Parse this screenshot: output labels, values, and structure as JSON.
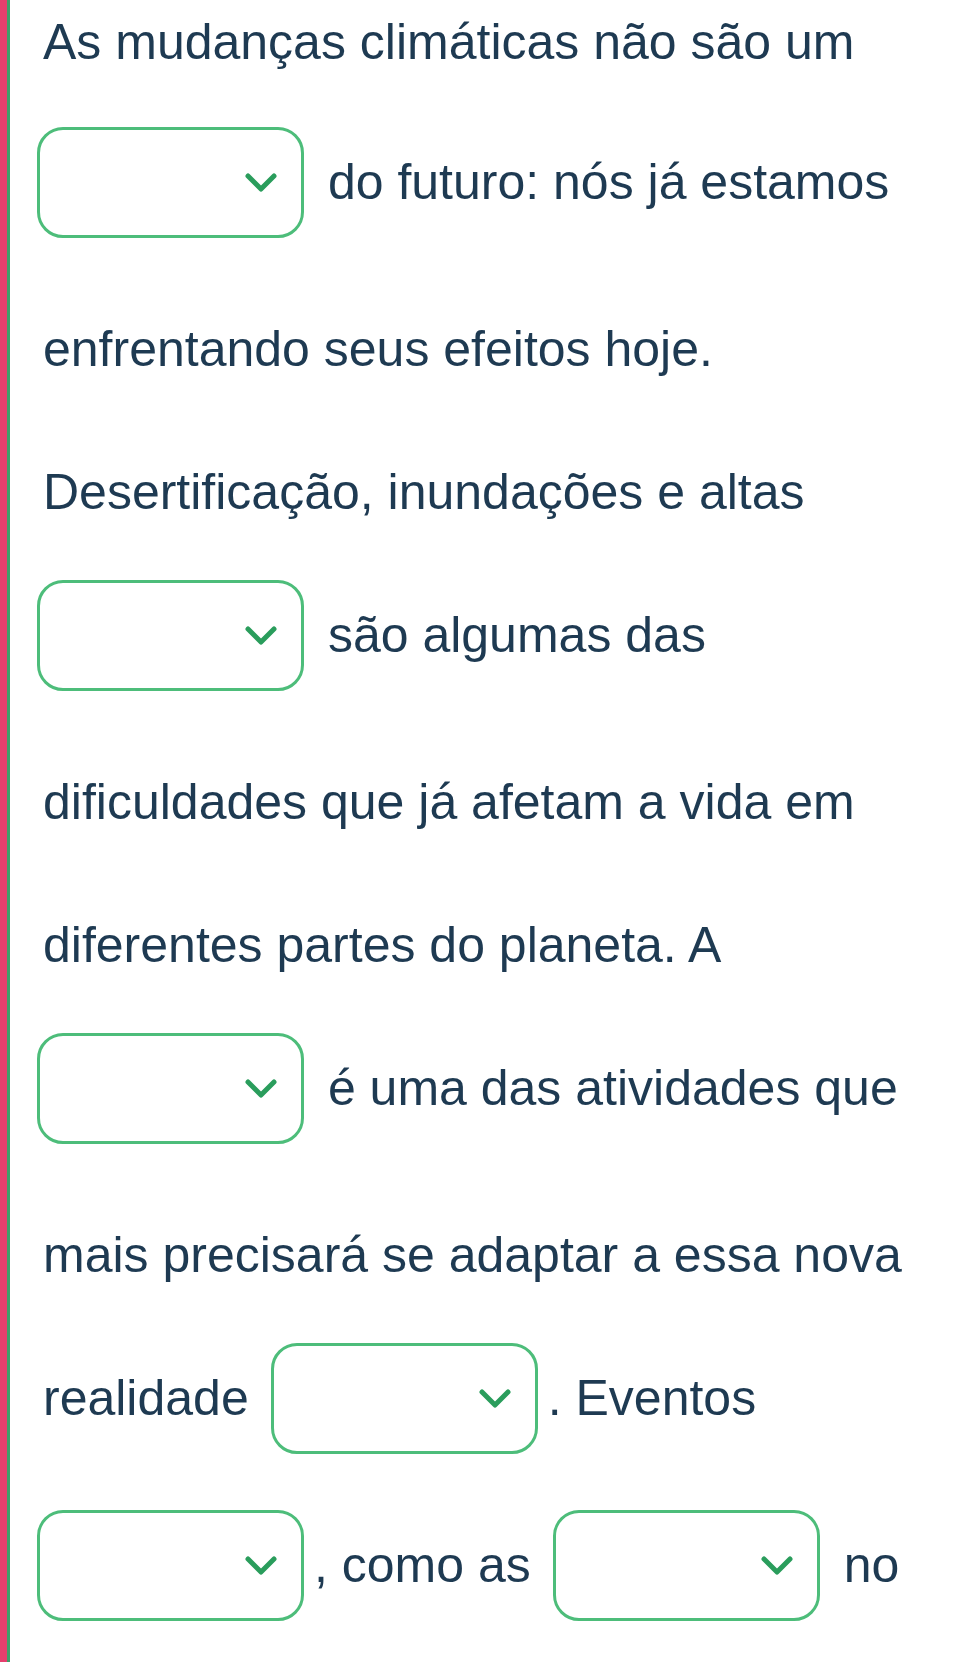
{
  "exercise": {
    "lines": [
      {
        "segments": [
          {
            "kind": "text",
            "text": "As mudanças climáticas não são um"
          }
        ]
      },
      {
        "segments": [
          {
            "kind": "dropdown"
          },
          {
            "kind": "text",
            "text": " do futuro: nós já estamos"
          }
        ]
      },
      {
        "segments": [
          {
            "kind": "text",
            "text": "enfrentando seus efeitos hoje."
          }
        ]
      },
      {
        "segments": [
          {
            "kind": "text",
            "text": "Desertificação, inundações e altas"
          }
        ]
      },
      {
        "segments": [
          {
            "kind": "dropdown"
          },
          {
            "kind": "text",
            "text": " são algumas das"
          }
        ]
      },
      {
        "segments": [
          {
            "kind": "text",
            "text": "dificuldades que já afetam a vida em"
          }
        ]
      },
      {
        "segments": [
          {
            "kind": "text",
            "text": "diferentes partes do planeta. A"
          }
        ]
      },
      {
        "segments": [
          {
            "kind": "dropdown"
          },
          {
            "kind": "text",
            "text": " é uma das atividades que"
          }
        ]
      },
      {
        "segments": [
          {
            "kind": "text",
            "text": "mais precisará se adaptar a essa nova"
          }
        ]
      },
      {
        "segments": [
          {
            "kind": "text",
            "text": "realidade"
          },
          {
            "kind": "dropdown"
          },
          {
            "kind": "text",
            "text": ". Eventos"
          }
        ]
      },
      {
        "segments": [
          {
            "kind": "dropdown"
          },
          {
            "kind": "text",
            "text": ", como as"
          },
          {
            "kind": "dropdown"
          },
          {
            "kind": "text",
            "text": " no"
          }
        ]
      }
    ]
  }
}
